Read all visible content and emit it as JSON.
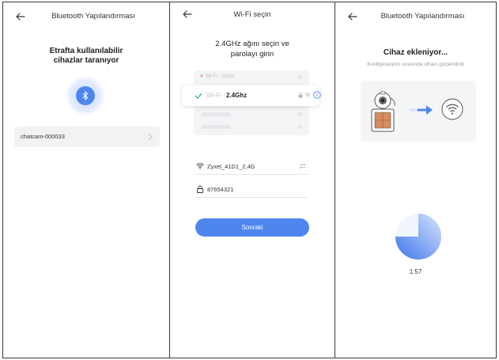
{
  "screens": [
    {
      "title": "Bluetooth Yapılandırması",
      "scan_line1": "Etrafta kullanılabilir",
      "scan_line2": "cihazlar taranıyor",
      "device": "chatcam-000033"
    },
    {
      "title": "Wi-Fi seçin",
      "instr_line1": "2.4GHz ağını seçin ve",
      "instr_line2": "parolayı girin",
      "option_5g": "Wi-Fi · 5Ghz",
      "option_24_prefix": "Wi-Fi ·",
      "option_24_name": "2.4Ghz",
      "ssid": "Zyxel_41D1_2,4G",
      "password": "87654321",
      "next_label": "Sonraki"
    },
    {
      "title": "Bluetooth Yapılandırması",
      "adding": "Cihaz ekleniyor...",
      "subtitle": "Konfigürasyon sırasında cihazı güçlendirdi",
      "timer": "1:57"
    }
  ],
  "colors": {
    "accent": "#4f86ee",
    "check": "#3cb371",
    "error_x": "#e86a6a"
  },
  "icons": [
    "back-arrow-icon",
    "bluetooth-icon",
    "chevron-right-icon",
    "check-icon",
    "lock-icon",
    "wifi-signal-icon",
    "info-icon",
    "wifi-icon",
    "swap-icon",
    "camera-icon",
    "arrow-right-icon",
    "spinner-icon"
  ]
}
